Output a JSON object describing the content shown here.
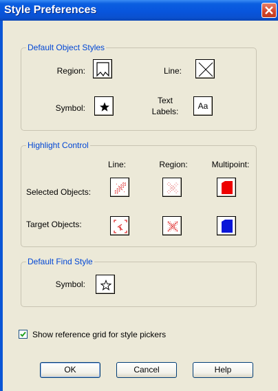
{
  "window": {
    "title": "Style Preferences"
  },
  "default_object_styles": {
    "title": "Default Object Styles",
    "region_label": "Region:",
    "line_label": "Line:",
    "symbol_label": "Symbol:",
    "text_label_line1": "Text",
    "text_label_line2": "Labels:",
    "text_button": "Aa"
  },
  "highlight_control": {
    "title": "Highlight Control",
    "col_line": "Line:",
    "col_region": "Region:",
    "col_multipoint": "Multipoint:",
    "row_selected": "Selected Objects:",
    "row_target": "Target Objects:"
  },
  "default_find_style": {
    "title": "Default Find Style",
    "symbol_label": "Symbol:"
  },
  "options": {
    "show_grid_label": "Show reference grid for style pickers",
    "show_grid_checked": true
  },
  "buttons": {
    "ok": "OK",
    "cancel": "Cancel",
    "help": "Help"
  },
  "colors": {
    "multipoint_selected": "#EE0000",
    "multipoint_target": "#0A16D8",
    "accent_title": "#0046D5"
  }
}
